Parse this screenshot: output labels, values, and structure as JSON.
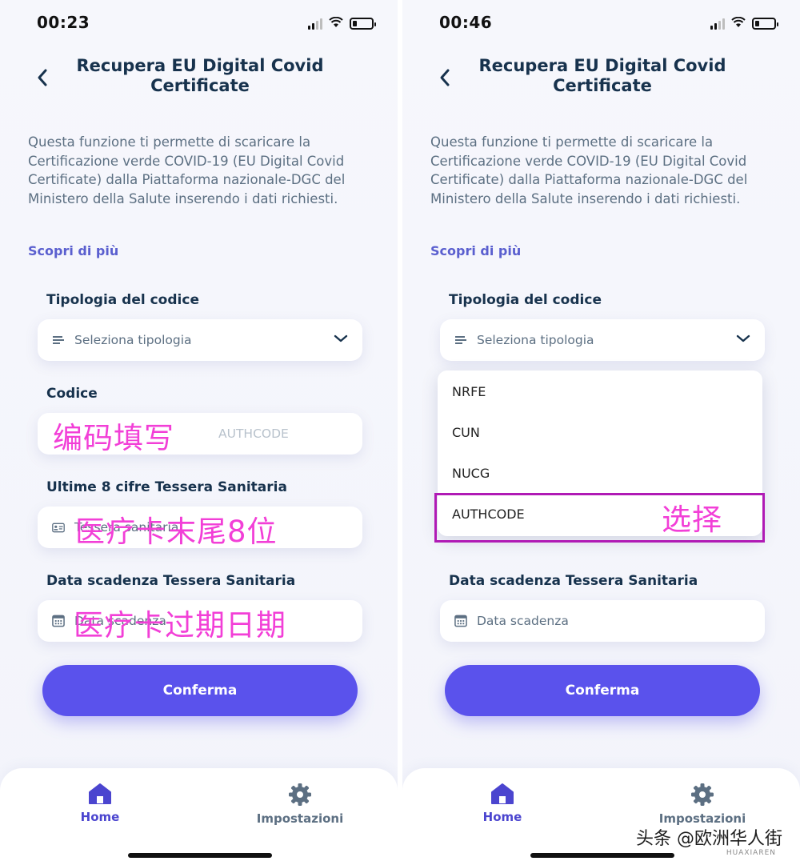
{
  "left": {
    "status": {
      "time": "00:23"
    },
    "title": "Recupera EU Digital Covid Certificate",
    "description": "Questa funzione ti permette di scaricare la Certificazione verde COVID-19 (EU Digital Covid Certificate) dalla Piattaforma nazionale-DGC del Ministero della Salute inserendo i dati richiesti.",
    "learn_more": "Scopri di più",
    "code_type": {
      "label": "Tipologia del codice",
      "value": "Seleziona tipologia"
    },
    "code": {
      "label": "Codice",
      "placeholder": "AUTHCODE"
    },
    "card_digits": {
      "label": "Ultime 8 cifre Tessera Sanitaria",
      "placeholder": "Tessera sanitaria"
    },
    "card_expiry": {
      "label": "Data scadenza Tessera Sanitaria",
      "placeholder": "Data scadenza"
    },
    "annotations": {
      "code": "编码填写",
      "card_digits": "医疗卡末尾8位",
      "card_expiry": "医疗卡过期日期"
    },
    "confirm_label": "Conferma",
    "tabs": {
      "home": "Home",
      "settings": "Impostazioni"
    }
  },
  "right": {
    "status": {
      "time": "00:46"
    },
    "title": "Recupera EU Digital Covid Certificate",
    "description": "Questa funzione ti permette di scaricare la Certificazione verde COVID-19 (EU Digital Covid Certificate) dalla Piattaforma nazionale-DGC del Ministero della Salute inserendo i dati richiesti.",
    "learn_more": "Scopri di più",
    "code_type": {
      "label": "Tipologia del codice",
      "value": "Seleziona tipologia"
    },
    "dropdown_options": [
      "NRFE",
      "CUN",
      "NUCG",
      "AUTHCODE"
    ],
    "annotation_select": "选择",
    "card_expiry": {
      "label": "Data scadenza Tessera Sanitaria",
      "placeholder": "Data scadenza"
    },
    "confirm_label": "Conferma",
    "tabs": {
      "home": "Home",
      "settings": "Impostazioni"
    }
  },
  "watermark": {
    "text": "头条 @欧洲华人街",
    "sub": "HUAXIAREN"
  },
  "colors": {
    "accent": "#5a52ec",
    "title": "#17324d",
    "annotation": "#f23fd7",
    "highlight": "#b01ab5"
  },
  "icons": [
    "back-chevron-icon",
    "list-icon",
    "chevron-down-icon",
    "id-card-icon",
    "calendar-icon",
    "home-icon",
    "gear-icon",
    "signal-icon",
    "wifi-icon",
    "battery-icon"
  ]
}
